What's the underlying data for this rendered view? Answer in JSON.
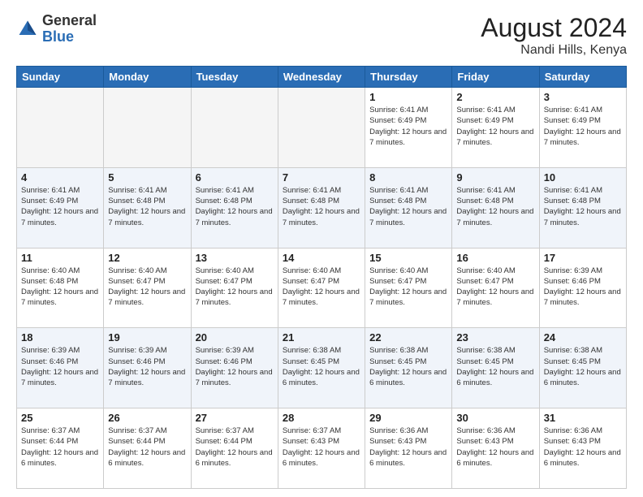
{
  "logo": {
    "general": "General",
    "blue": "Blue"
  },
  "title": "August 2024",
  "location": "Nandi Hills, Kenya",
  "days_of_week": [
    "Sunday",
    "Monday",
    "Tuesday",
    "Wednesday",
    "Thursday",
    "Friday",
    "Saturday"
  ],
  "weeks": [
    [
      {
        "day": "",
        "empty": true
      },
      {
        "day": "",
        "empty": true
      },
      {
        "day": "",
        "empty": true
      },
      {
        "day": "",
        "empty": true
      },
      {
        "day": "1",
        "sunrise": "Sunrise: 6:41 AM",
        "sunset": "Sunset: 6:49 PM",
        "daylight": "Daylight: 12 hours and 7 minutes."
      },
      {
        "day": "2",
        "sunrise": "Sunrise: 6:41 AM",
        "sunset": "Sunset: 6:49 PM",
        "daylight": "Daylight: 12 hours and 7 minutes."
      },
      {
        "day": "3",
        "sunrise": "Sunrise: 6:41 AM",
        "sunset": "Sunset: 6:49 PM",
        "daylight": "Daylight: 12 hours and 7 minutes."
      }
    ],
    [
      {
        "day": "4",
        "sunrise": "Sunrise: 6:41 AM",
        "sunset": "Sunset: 6:49 PM",
        "daylight": "Daylight: 12 hours and 7 minutes."
      },
      {
        "day": "5",
        "sunrise": "Sunrise: 6:41 AM",
        "sunset": "Sunset: 6:48 PM",
        "daylight": "Daylight: 12 hours and 7 minutes."
      },
      {
        "day": "6",
        "sunrise": "Sunrise: 6:41 AM",
        "sunset": "Sunset: 6:48 PM",
        "daylight": "Daylight: 12 hours and 7 minutes."
      },
      {
        "day": "7",
        "sunrise": "Sunrise: 6:41 AM",
        "sunset": "Sunset: 6:48 PM",
        "daylight": "Daylight: 12 hours and 7 minutes."
      },
      {
        "day": "8",
        "sunrise": "Sunrise: 6:41 AM",
        "sunset": "Sunset: 6:48 PM",
        "daylight": "Daylight: 12 hours and 7 minutes."
      },
      {
        "day": "9",
        "sunrise": "Sunrise: 6:41 AM",
        "sunset": "Sunset: 6:48 PM",
        "daylight": "Daylight: 12 hours and 7 minutes."
      },
      {
        "day": "10",
        "sunrise": "Sunrise: 6:41 AM",
        "sunset": "Sunset: 6:48 PM",
        "daylight": "Daylight: 12 hours and 7 minutes."
      }
    ],
    [
      {
        "day": "11",
        "sunrise": "Sunrise: 6:40 AM",
        "sunset": "Sunset: 6:48 PM",
        "daylight": "Daylight: 12 hours and 7 minutes."
      },
      {
        "day": "12",
        "sunrise": "Sunrise: 6:40 AM",
        "sunset": "Sunset: 6:47 PM",
        "daylight": "Daylight: 12 hours and 7 minutes."
      },
      {
        "day": "13",
        "sunrise": "Sunrise: 6:40 AM",
        "sunset": "Sunset: 6:47 PM",
        "daylight": "Daylight: 12 hours and 7 minutes."
      },
      {
        "day": "14",
        "sunrise": "Sunrise: 6:40 AM",
        "sunset": "Sunset: 6:47 PM",
        "daylight": "Daylight: 12 hours and 7 minutes."
      },
      {
        "day": "15",
        "sunrise": "Sunrise: 6:40 AM",
        "sunset": "Sunset: 6:47 PM",
        "daylight": "Daylight: 12 hours and 7 minutes."
      },
      {
        "day": "16",
        "sunrise": "Sunrise: 6:40 AM",
        "sunset": "Sunset: 6:47 PM",
        "daylight": "Daylight: 12 hours and 7 minutes."
      },
      {
        "day": "17",
        "sunrise": "Sunrise: 6:39 AM",
        "sunset": "Sunset: 6:46 PM",
        "daylight": "Daylight: 12 hours and 7 minutes."
      }
    ],
    [
      {
        "day": "18",
        "sunrise": "Sunrise: 6:39 AM",
        "sunset": "Sunset: 6:46 PM",
        "daylight": "Daylight: 12 hours and 7 minutes."
      },
      {
        "day": "19",
        "sunrise": "Sunrise: 6:39 AM",
        "sunset": "Sunset: 6:46 PM",
        "daylight": "Daylight: 12 hours and 7 minutes."
      },
      {
        "day": "20",
        "sunrise": "Sunrise: 6:39 AM",
        "sunset": "Sunset: 6:46 PM",
        "daylight": "Daylight: 12 hours and 7 minutes."
      },
      {
        "day": "21",
        "sunrise": "Sunrise: 6:38 AM",
        "sunset": "Sunset: 6:45 PM",
        "daylight": "Daylight: 12 hours and 6 minutes."
      },
      {
        "day": "22",
        "sunrise": "Sunrise: 6:38 AM",
        "sunset": "Sunset: 6:45 PM",
        "daylight": "Daylight: 12 hours and 6 minutes."
      },
      {
        "day": "23",
        "sunrise": "Sunrise: 6:38 AM",
        "sunset": "Sunset: 6:45 PM",
        "daylight": "Daylight: 12 hours and 6 minutes."
      },
      {
        "day": "24",
        "sunrise": "Sunrise: 6:38 AM",
        "sunset": "Sunset: 6:45 PM",
        "daylight": "Daylight: 12 hours and 6 minutes."
      }
    ],
    [
      {
        "day": "25",
        "sunrise": "Sunrise: 6:37 AM",
        "sunset": "Sunset: 6:44 PM",
        "daylight": "Daylight: 12 hours and 6 minutes."
      },
      {
        "day": "26",
        "sunrise": "Sunrise: 6:37 AM",
        "sunset": "Sunset: 6:44 PM",
        "daylight": "Daylight: 12 hours and 6 minutes."
      },
      {
        "day": "27",
        "sunrise": "Sunrise: 6:37 AM",
        "sunset": "Sunset: 6:44 PM",
        "daylight": "Daylight: 12 hours and 6 minutes."
      },
      {
        "day": "28",
        "sunrise": "Sunrise: 6:37 AM",
        "sunset": "Sunset: 6:43 PM",
        "daylight": "Daylight: 12 hours and 6 minutes."
      },
      {
        "day": "29",
        "sunrise": "Sunrise: 6:36 AM",
        "sunset": "Sunset: 6:43 PM",
        "daylight": "Daylight: 12 hours and 6 minutes."
      },
      {
        "day": "30",
        "sunrise": "Sunrise: 6:36 AM",
        "sunset": "Sunset: 6:43 PM",
        "daylight": "Daylight: 12 hours and 6 minutes."
      },
      {
        "day": "31",
        "sunrise": "Sunrise: 6:36 AM",
        "sunset": "Sunset: 6:43 PM",
        "daylight": "Daylight: 12 hours and 6 minutes."
      }
    ]
  ]
}
